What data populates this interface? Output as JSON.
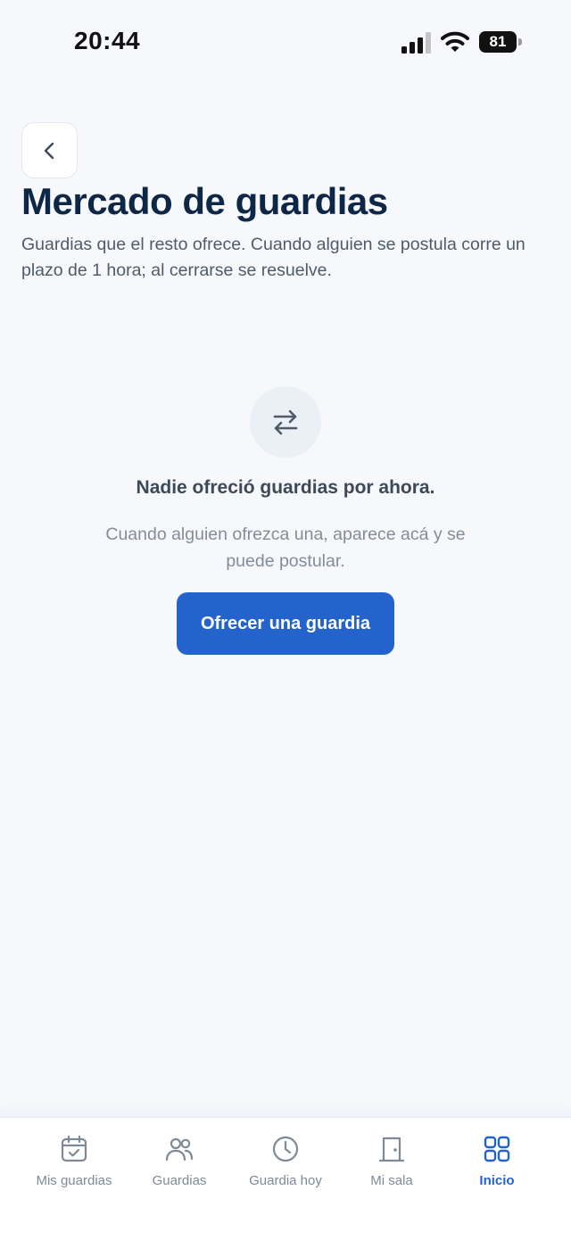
{
  "status_bar": {
    "time": "20:44",
    "battery": "81",
    "icons": [
      "signal-icon",
      "wifi-icon",
      "battery-icon"
    ]
  },
  "header": {
    "back_icon": "chevron-left-icon",
    "title": "Mercado de guardias",
    "subtitle": "Guardias que el resto ofrece. Cuando alguien se postula corre un plazo de 1 hora; al cerrarse se resuelve."
  },
  "empty_state": {
    "icon": "swap-arrows-icon",
    "title": "Nadie ofreció guardias por ahora.",
    "description": "Cuando alguien ofrezca una, aparece acá y se puede postular.",
    "button_label": "Ofrecer una guardia"
  },
  "bottom_nav": {
    "items": [
      {
        "label": "Mis guardias",
        "icon": "calendar-check-icon",
        "active": false
      },
      {
        "label": "Guardias",
        "icon": "users-icon",
        "active": false
      },
      {
        "label": "Guardia hoy",
        "icon": "clock-icon",
        "active": false
      },
      {
        "label": "Mi sala",
        "icon": "door-icon",
        "active": false
      },
      {
        "label": "Inicio",
        "icon": "grid-icon",
        "active": true
      }
    ]
  },
  "colors": {
    "background": "#f6f8fc",
    "title": "#0f2746",
    "accent": "#2563cc",
    "nav_inactive": "#7e8a98"
  }
}
